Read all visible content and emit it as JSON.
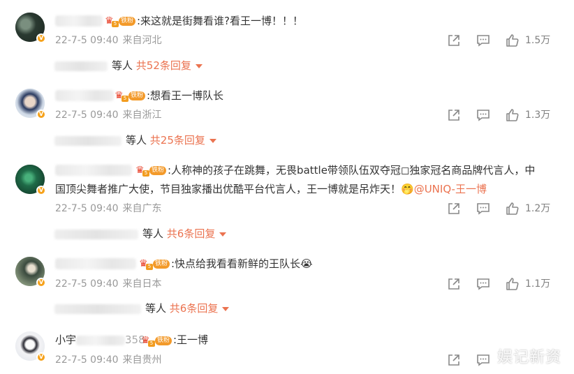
{
  "comments": [
    {
      "text": ":来这就是街舞看谁?看王一博！！！",
      "time": "22-7-5 09:40",
      "location": "来自河北",
      "likes": "1.5万",
      "reply_suffix": "等人",
      "reply_count": "共52条回复"
    },
    {
      "text": ":想看王一博队长",
      "time": "22-7-5 09:40",
      "location": "来自浙江",
      "likes": "1.3万",
      "reply_suffix": "等人",
      "reply_count": "共25条回复"
    },
    {
      "text_line1": ":人称神的孩子在跳舞，无畏battle带领队伍双夺冠◻独家冠名商品牌代言人，中",
      "text_line2": "国顶尖舞者推广大使，节目独家播出优酷平台代言人，王一博就是吊炸天！",
      "emoji": "🤭",
      "mention": "@UNIQ-王一博",
      "time": "22-7-5 09:40",
      "location": "来自广东",
      "likes": "1.2万",
      "reply_suffix": "等人",
      "reply_count": "共6条回复"
    },
    {
      "text": ":快点给我看看新鲜的王队长",
      "emoji": "😭",
      "time": "22-7-5 09:40",
      "location": "来自日本",
      "likes": "1.1万",
      "reply_suffix": "等人",
      "reply_count": "共6条回复"
    },
    {
      "name_partial": "小宇",
      "name_suffix": "358",
      "text": ":王一博",
      "time": "22-7-5 09:40",
      "location": "来自贵州"
    }
  ],
  "fan_badge": {
    "level": "5",
    "label": "铁粉"
  },
  "verified_badge": "V",
  "watermark": "娱记新资",
  "colors": {
    "accent": "#eb7350",
    "meta": "#999999",
    "badge": "#f39a2a"
  },
  "icons": [
    "share-icon",
    "comment-icon",
    "like-icon"
  ]
}
